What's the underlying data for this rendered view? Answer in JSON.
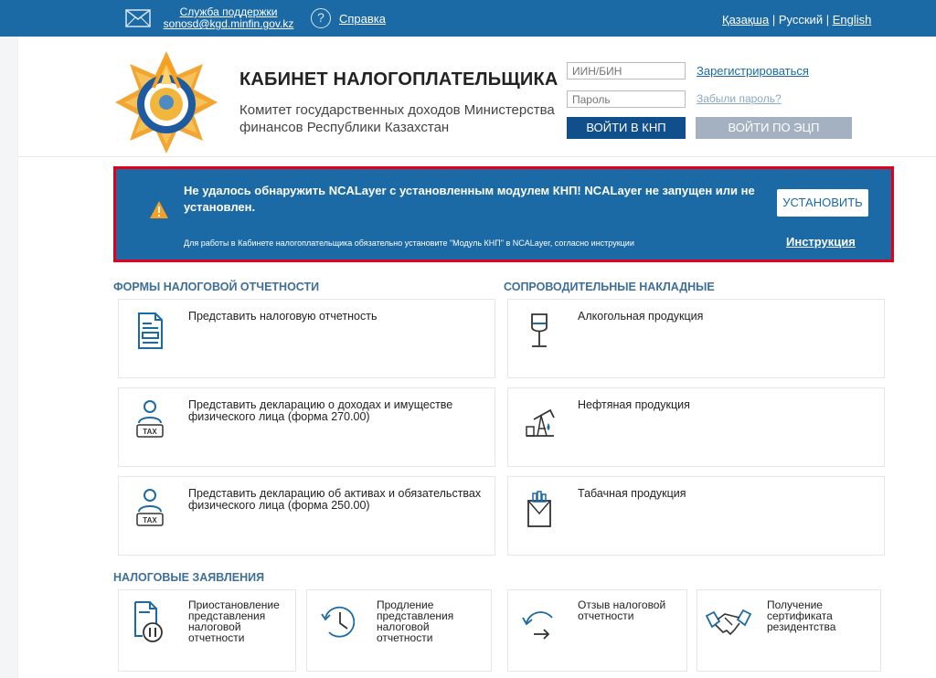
{
  "header": {
    "support_line1": "Служба поддержки",
    "support_line2": "sonosd@kgd.minfin.gov.kz",
    "help_label": "Справка",
    "languages": [
      "Қазақша",
      "Русский",
      "English"
    ],
    "separator": "|"
  },
  "brand": {
    "title": "КАБИНЕТ НАЛОГОПЛАТЕЛЬЩИКА",
    "subtitle": "Комитет государственных доходов Министерства финансов Республики Казахстан"
  },
  "login": {
    "iin_placeholder": "ИИН/БИН",
    "password_placeholder": "Пароль",
    "login_button": "ВОЙТИ В КНП",
    "register_link": "Зарегистрироваться",
    "forgot_link": "Забыли пароль?",
    "ecp_button": "ВОЙТИ ПО ЭЦП"
  },
  "alert": {
    "title": "Не удалось обнаружить NCALayer с установленным модулем КНП! NCALayer не запущен или не установлен.",
    "note": "Для работы в Кабинете налогоплательщика обязательно установите \"Модуль КНП\" в NCALayer, согласно инструкции",
    "install_button": "УСТАНОВИТЬ",
    "instruction_link": "Инструкция"
  },
  "sections": {
    "tax_forms": {
      "title": "ФОРМЫ НАЛОГОВОЙ ОТЧЕТНОСТИ",
      "cards": [
        {
          "label": "Представить налоговую отчетность",
          "icon": "document-icon"
        },
        {
          "label": "Представить декларацию о доходах и имуществе физического лица (форма 270.00)",
          "icon": "tax-person-icon",
          "icon_text": "TAX"
        },
        {
          "label": "Представить декларацию об активах и обязательствах физического лица (форма 250.00)",
          "icon": "tax-person-icon",
          "icon_text": "TAX"
        }
      ]
    },
    "waybills": {
      "title": "СОПРОВОДИТЕЛЬНЫЕ НАКЛАДНЫЕ",
      "cards": [
        {
          "label": "Алкогольная продукция",
          "icon": "wine-glass-icon"
        },
        {
          "label": "Нефтяная продукция",
          "icon": "oil-pump-icon"
        },
        {
          "label": "Табачная продукция",
          "icon": "cigarette-pack-icon"
        }
      ]
    },
    "applications": {
      "title": "НАЛОГОВЫЕ ЗАЯВЛЕНИЯ",
      "cards": [
        {
          "label": "Приостановление представления налоговой отчетности",
          "icon": "pause-document-icon"
        },
        {
          "label": "Продление представления налоговой отчетности",
          "icon": "clock-back-icon"
        },
        {
          "label": "Отзыв налоговой отчетности",
          "icon": "withdraw-arrow-icon"
        },
        {
          "label": "Получение сертификата резидентства",
          "icon": "handshake-icon"
        }
      ]
    }
  },
  "colors": {
    "header_bg": "#1b6aa5",
    "alert_border": "#e3001b",
    "login_button": "#114f8c",
    "ecp_button": "#a3b1c0",
    "section_title": "#3e6f99",
    "icon_stroke": "#1b6aa5"
  }
}
